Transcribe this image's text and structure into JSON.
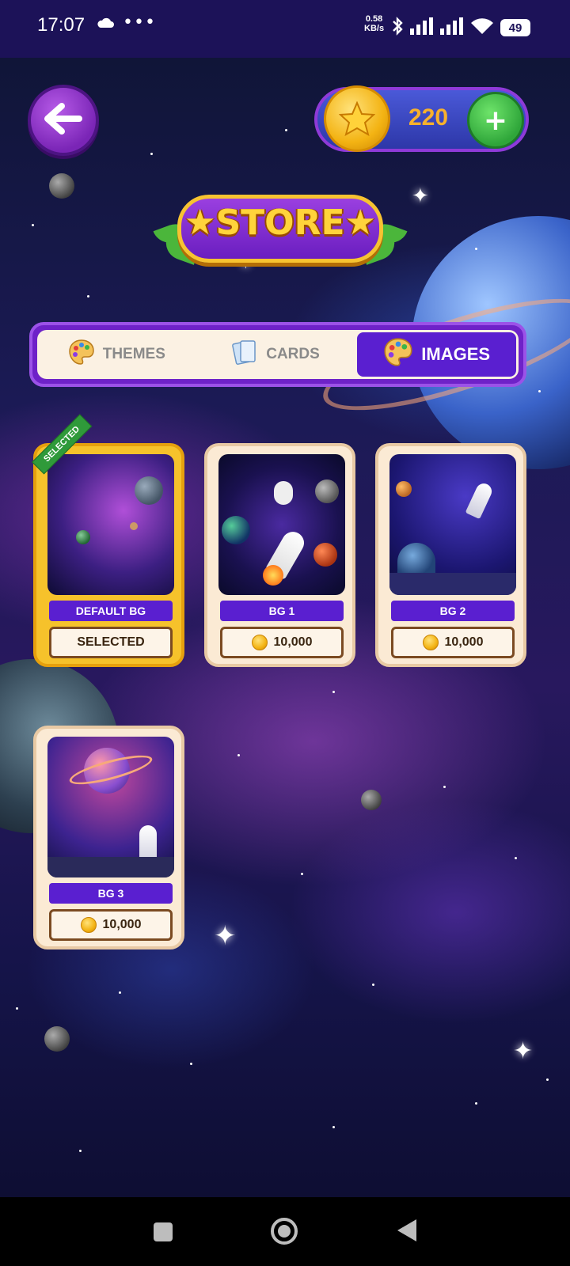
{
  "status_bar": {
    "time": "17:07",
    "speed_value": "0.58",
    "speed_unit": "KB/s",
    "battery": "49"
  },
  "header": {
    "back_icon": "arrow-left-icon",
    "coins": "220",
    "add_label": "+"
  },
  "banner": {
    "title": "★STORE★"
  },
  "tabs": [
    {
      "label": "THEMES",
      "icon": "palette-icon",
      "active": false
    },
    {
      "label": "CARDS",
      "icon": "cards-icon",
      "active": false
    },
    {
      "label": "IMAGES",
      "icon": "palette-icon",
      "active": true
    }
  ],
  "items": [
    {
      "name": "DEFAULT BG",
      "action": "SELECTED",
      "ribbon": "SELECTED",
      "selected": true
    },
    {
      "name": "BG 1",
      "price": "10,000",
      "selected": false
    },
    {
      "name": "BG 2",
      "price": "10,000",
      "selected": false
    },
    {
      "name": "BG 3",
      "price": "10,000",
      "selected": false
    }
  ],
  "colors": {
    "accent_purple": "#5a1fd0",
    "coin_gold": "#f3b313",
    "add_green": "#2fa63a",
    "selected_gold": "#f6c22b"
  }
}
